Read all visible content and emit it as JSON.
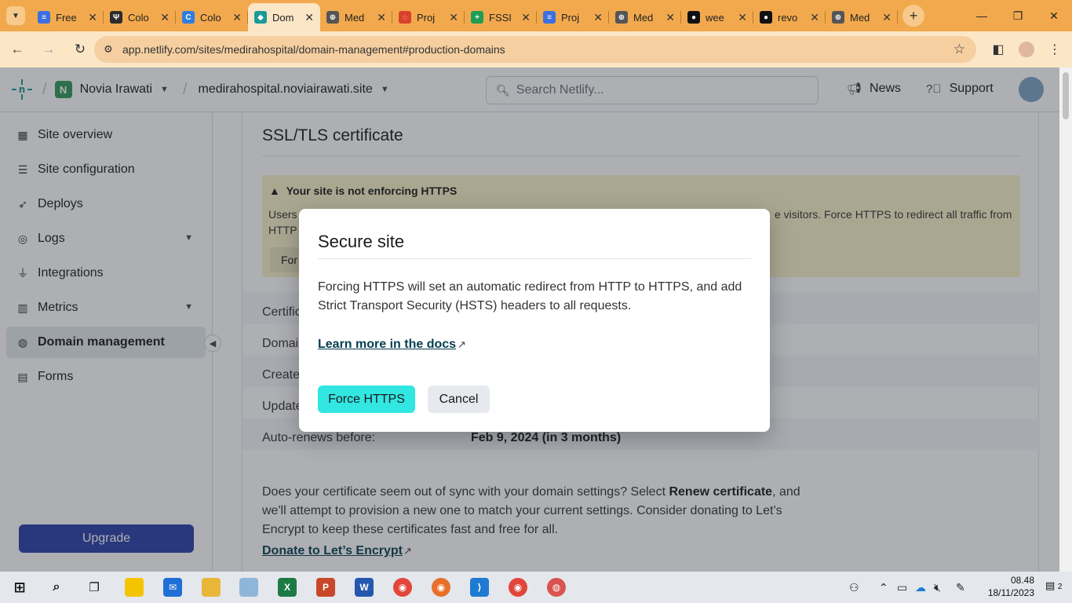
{
  "browser": {
    "tabs": [
      {
        "title": "Free",
        "color": "#3c6fe0",
        "glyph": "≡"
      },
      {
        "title": "Colo",
        "color": "#2c2c2c",
        "glyph": "Ψ"
      },
      {
        "title": "Colo",
        "color": "#2f7de1",
        "glyph": "C"
      },
      {
        "title": "Dom",
        "color": "#1a9a96",
        "glyph": "◆"
      },
      {
        "title": "Med",
        "color": "#555555",
        "glyph": "⊕"
      },
      {
        "title": "Proj",
        "color": "#d9412a",
        "glyph": "◌"
      },
      {
        "title": "FSSI",
        "color": "#1f9d55",
        "glyph": "+"
      },
      {
        "title": "Proj",
        "color": "#3c6fe0",
        "glyph": "≡"
      },
      {
        "title": "Med",
        "color": "#555555",
        "glyph": "⊕"
      },
      {
        "title": "wee",
        "color": "#111111",
        "glyph": "●"
      },
      {
        "title": "revo",
        "color": "#111111",
        "glyph": "●"
      },
      {
        "title": "Med",
        "color": "#555555",
        "glyph": "⊕"
      }
    ],
    "url": "app.netlify.com/sites/medirahospital/domain-management#production-domains"
  },
  "topnav": {
    "team_initial": "N",
    "team_name": "Novia Irawati",
    "site_name": "medirahospital.noviairawati.site",
    "search_placeholder": "Search Netlify...",
    "news": "News",
    "support": "Support"
  },
  "sidebar": {
    "items": [
      {
        "label": "Site overview",
        "icon": "grid-icon"
      },
      {
        "label": "Site configuration",
        "icon": "sliders-icon"
      },
      {
        "label": "Deploys",
        "icon": "rocket-icon"
      },
      {
        "label": "Logs",
        "icon": "logs-icon"
      },
      {
        "label": "Integrations",
        "icon": "plug-icon"
      },
      {
        "label": "Metrics",
        "icon": "bar-chart-icon"
      },
      {
        "label": "Domain management",
        "icon": "globe-icon"
      },
      {
        "label": "Forms",
        "icon": "form-icon"
      }
    ],
    "upgrade": "Upgrade"
  },
  "main": {
    "title": "SSL/TLS certificate",
    "warning_title": "Your site is not enforcing HTTPS",
    "warning_body_left": "Users",
    "warning_body_left2": "HTTP t",
    "warning_body_right": "e visitors. Force HTTPS to redirect all traffic from",
    "warning_button": "For",
    "rows": [
      {
        "label": "Certific",
        "value": ""
      },
      {
        "label": "Domai",
        "value": ""
      },
      {
        "label": "Create",
        "value": ""
      },
      {
        "label": "Update",
        "value": ""
      },
      {
        "label": "Auto-renews before:",
        "value": "Feb 9, 2024 (in 3 months)"
      }
    ],
    "para_1": "Does your certificate seem out of sync with your domain settings? Select ",
    "para_bold": "Renew certificate",
    "para_2": ", and we'll attempt to provision a new one to match your current settings. Consider donating to Let’s Encrypt to keep these certificates fast and free for all.",
    "donate": "Donate to Let’s Encrypt"
  },
  "modal": {
    "title": "Secure site",
    "description": "Forcing HTTPS will set an automatic redirect from HTTP to HTTPS, and add Strict Transport Security (HSTS) headers to all requests.",
    "learn_more": "Learn more in the docs",
    "force_button": "Force HTTPS",
    "cancel_button": "Cancel"
  },
  "taskbar": {
    "time": "08.48",
    "date": "18/11/2023",
    "notifications": "2"
  }
}
